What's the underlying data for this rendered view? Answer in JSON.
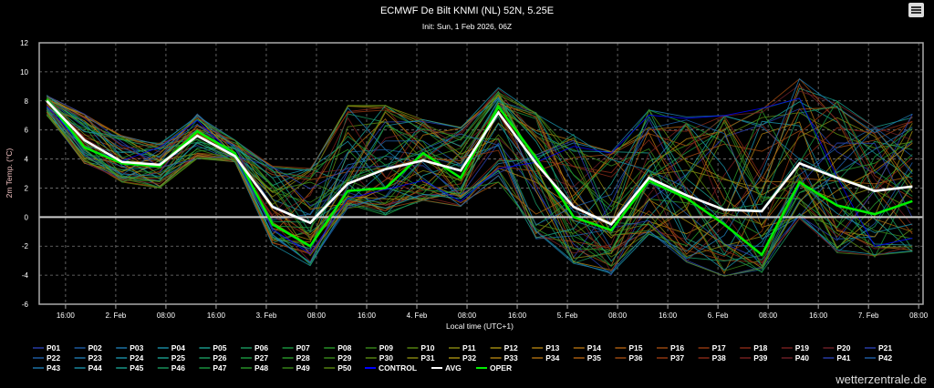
{
  "chart_data": {
    "type": "line",
    "title": "ECMWF De Bilt KNMI (NL) 52N, 5.25E",
    "subtitle": "Init: Sun, 1 Feb 2026, 06Z",
    "xlabel": "Local time (UTC+1)",
    "ylabel": "2m Temp. (°C)",
    "x_units": "hours since 1 Feb 00:00 local",
    "xlim": [
      11.8,
      152.7
    ],
    "ylim": [
      -6,
      12
    ],
    "yticks": [
      -6,
      -4,
      -2,
      0,
      2,
      4,
      6,
      8,
      10,
      12
    ],
    "xticks": [
      {
        "x": 16,
        "label": "16:00"
      },
      {
        "x": 24,
        "label": "2. Feb"
      },
      {
        "x": 32,
        "label": "08:00"
      },
      {
        "x": 40,
        "label": "16:00"
      },
      {
        "x": 48,
        "label": "3. Feb"
      },
      {
        "x": 56,
        "label": "08:00"
      },
      {
        "x": 64,
        "label": "16:00"
      },
      {
        "x": 72,
        "label": "4. Feb"
      },
      {
        "x": 80,
        "label": "08:00"
      },
      {
        "x": 88,
        "label": "16:00"
      },
      {
        "x": 96,
        "label": "5. Feb"
      },
      {
        "x": 104,
        "label": "08:00"
      },
      {
        "x": 112,
        "label": "16:00"
      },
      {
        "x": 120,
        "label": "6. Feb"
      },
      {
        "x": 128,
        "label": "08:00"
      },
      {
        "x": 136,
        "label": "16:00"
      },
      {
        "x": 144,
        "label": "7. Feb"
      },
      {
        "x": 152,
        "label": "08:00"
      }
    ],
    "grid": true,
    "legend_position": "bottom",
    "x": [
      13,
      19,
      25,
      31,
      37,
      43,
      49,
      55,
      61,
      67,
      73,
      79,
      85,
      91,
      97,
      103,
      109,
      115,
      121,
      127,
      133,
      139,
      145,
      151
    ],
    "series": [
      {
        "name": "AVG",
        "color": "#ffffff",
        "values": [
          8.0,
          5.3,
          3.8,
          3.6,
          5.6,
          4.2,
          0.7,
          -0.4,
          2.3,
          3.3,
          3.9,
          3.2,
          7.2,
          3.7,
          0.7,
          -0.5,
          2.7,
          1.5,
          0.5,
          0.4,
          3.7,
          2.7,
          1.8,
          2.1
        ]
      },
      {
        "name": "OPER",
        "color": "#00ee00",
        "values": [
          8.1,
          4.8,
          3.7,
          3.5,
          5.9,
          4.4,
          -0.5,
          -2.0,
          1.8,
          2.0,
          4.4,
          2.7,
          7.6,
          4.1,
          0.0,
          -0.9,
          2.5,
          1.3,
          -0.5,
          -2.6,
          2.4,
          0.8,
          0.2,
          1.1
        ]
      }
    ],
    "ensemble_envelope": {
      "min": [
        7.0,
        3.7,
        2.4,
        2.0,
        4.0,
        3.8,
        -1.9,
        -3.4,
        0.6,
        0.1,
        1.1,
        0.7,
        2.4,
        -1.5,
        -3.2,
        -4.0,
        -1.2,
        -3.1,
        -4.1,
        -4.0,
        -0.1,
        -2.5,
        -2.8,
        -2.4
      ],
      "max": [
        8.4,
        7.1,
        5.6,
        5.1,
        7.1,
        5.3,
        3.5,
        3.4,
        7.7,
        7.7,
        6.7,
        6.2,
        8.9,
        7.2,
        5.7,
        4.5,
        7.4,
        6.9,
        7.0,
        7.5,
        9.6,
        8.0,
        6.2,
        7.1
      ]
    },
    "member_palette": [
      "#2a3fb0",
      "#1f5fa8",
      "#1f7ab0",
      "#1a90a8",
      "#1aa090",
      "#1a9a60",
      "#1a9a40",
      "#2a9a2a",
      "#3a8a1a",
      "#5a8a10",
      "#8a8a10",
      "#a89010",
      "#b08010",
      "#b07010",
      "#b06010",
      "#a04a10",
      "#983a10",
      "#8a2a18",
      "#7a2020",
      "#702028"
    ],
    "members": [
      "P01",
      "P02",
      "P03",
      "P04",
      "P05",
      "P06",
      "P07",
      "P08",
      "P09",
      "P10",
      "P11",
      "P12",
      "P13",
      "P14",
      "P15",
      "P16",
      "P17",
      "P18",
      "P19",
      "P20",
      "P21",
      "P22",
      "P23",
      "P24",
      "P25",
      "P26",
      "P27",
      "P28",
      "P29",
      "P30",
      "P31",
      "P32",
      "P33",
      "P34",
      "P35",
      "P36",
      "P37",
      "P38",
      "P39",
      "P40",
      "P41",
      "P42",
      "P43",
      "P44",
      "P45",
      "P46",
      "P47",
      "P48",
      "P49",
      "P50"
    ],
    "control": {
      "name": "CONTROL",
      "color": "#0000ff"
    },
    "legend": [
      "P01",
      "P02",
      "P03",
      "P04",
      "P05",
      "P06",
      "P07",
      "P08",
      "P09",
      "P10",
      "P11",
      "P12",
      "P13",
      "P14",
      "P15",
      "P16",
      "P17",
      "P18",
      "P19",
      "P20",
      "P21",
      "P22",
      "P23",
      "P24",
      "P25",
      "P26",
      "P27",
      "P28",
      "P29",
      "P30",
      "P31",
      "P32",
      "P33",
      "P34",
      "P35",
      "P36",
      "P37",
      "P38",
      "P39",
      "P40",
      "P41",
      "P42",
      "P43",
      "P44",
      "P45",
      "P46",
      "P47",
      "P48",
      "P49",
      "P50",
      "CONTROL",
      "AVG",
      "OPER"
    ]
  },
  "watermark": "wetterzentrale.de",
  "menu_icon": "hamburger-menu-icon"
}
